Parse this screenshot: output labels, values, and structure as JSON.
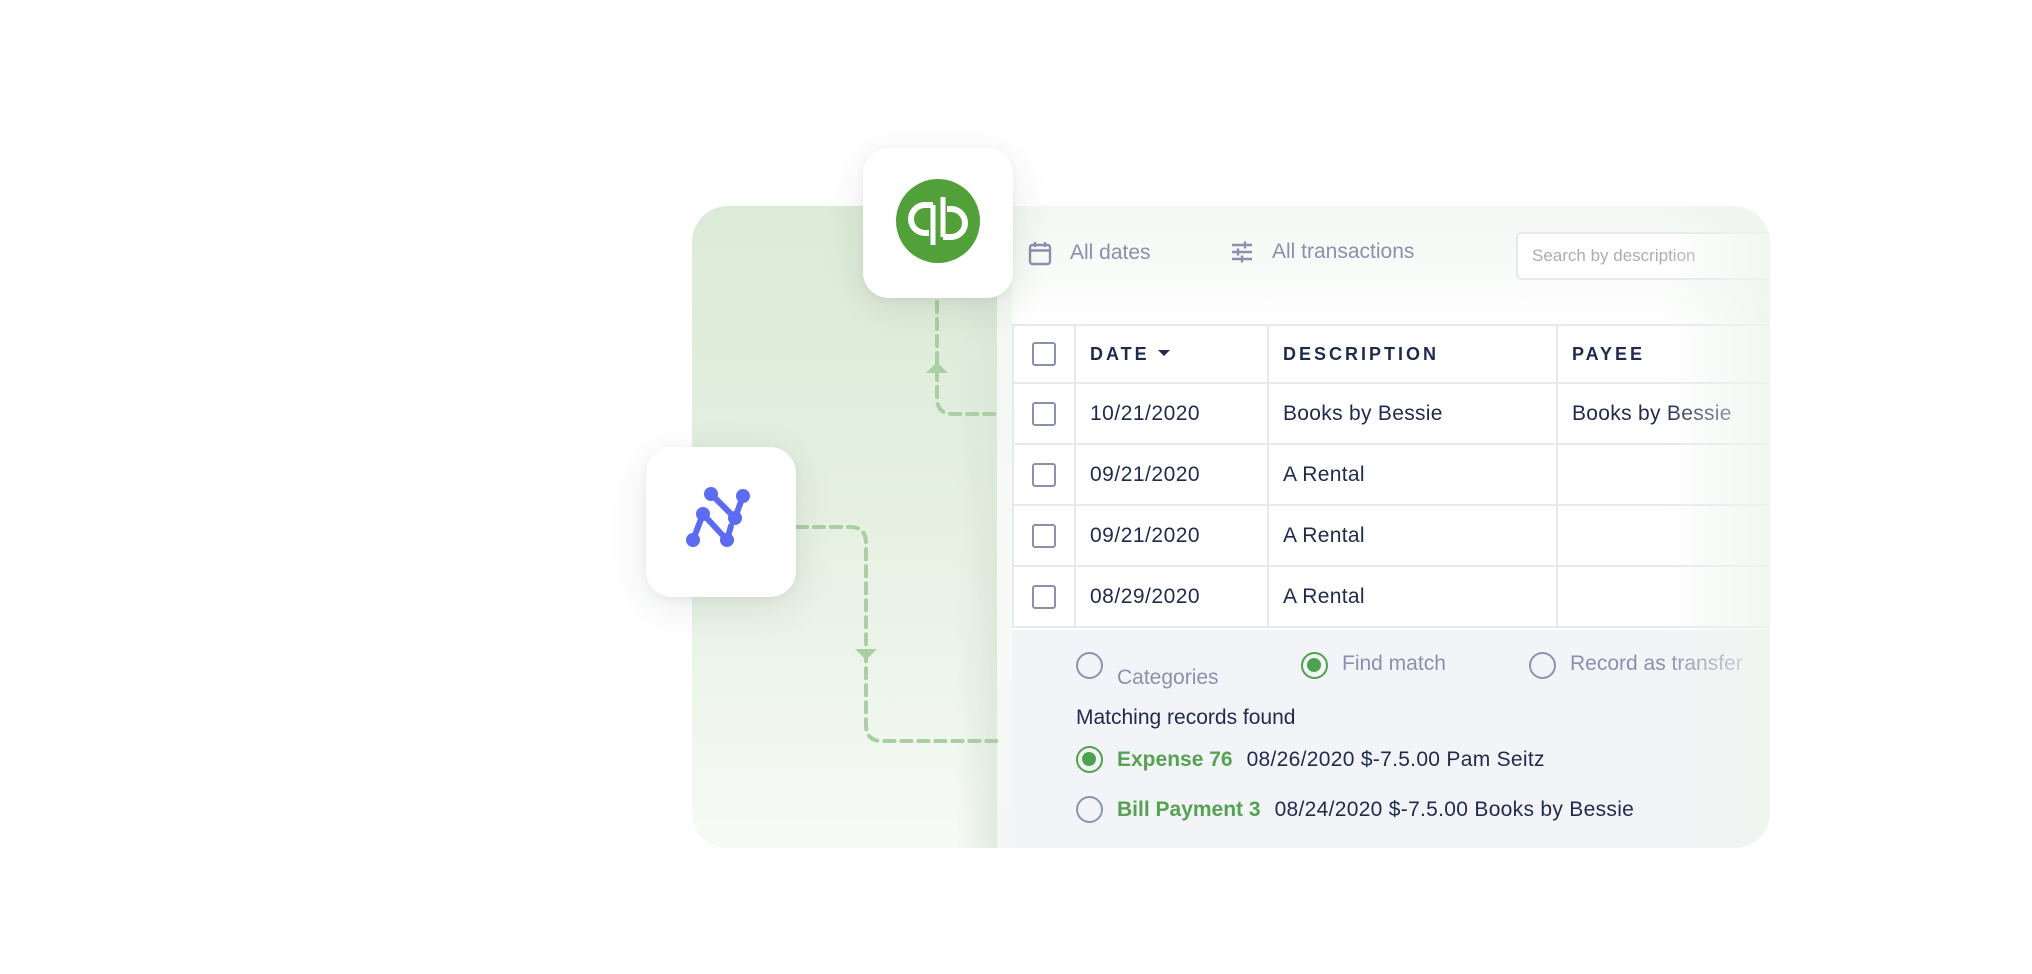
{
  "apps": {
    "source": {
      "name": "QuickBooks",
      "icon": "quickbooks-logo-icon",
      "color": "#52a03a"
    },
    "target": {
      "name": "integration-node-logo",
      "icon": "node-graph-logo-icon",
      "color": "#5b6cf2"
    }
  },
  "toolbar": {
    "date_filter": {
      "icon": "calendar-icon",
      "label": "All dates"
    },
    "type_filter": {
      "icon": "sliders-icon",
      "label": "All transactions"
    },
    "search": {
      "placeholder": "Search by description",
      "value": ""
    }
  },
  "table": {
    "columns": [
      {
        "key": "select",
        "label": ""
      },
      {
        "key": "date",
        "label": "DATE",
        "sorted": "desc"
      },
      {
        "key": "description",
        "label": "DESCRIPTION"
      },
      {
        "key": "payee",
        "label": "PAYEE"
      }
    ],
    "rows": [
      {
        "checked": false,
        "date": "10/21/2020",
        "description": "Books by Bessie",
        "payee": "Books by Bessie"
      },
      {
        "checked": false,
        "date": "09/21/2020",
        "description": "A Rental",
        "payee": ""
      },
      {
        "checked": false,
        "date": "09/21/2020",
        "description": "A Rental",
        "payee": ""
      },
      {
        "checked": false,
        "date": "08/29/2020",
        "description": "A Rental",
        "payee": ""
      }
    ]
  },
  "match_panel": {
    "options": [
      {
        "label": "Categories",
        "selected": false
      },
      {
        "label": "Find match",
        "selected": true
      },
      {
        "label": "Record as transfer",
        "selected": false
      }
    ],
    "heading": "Matching records found",
    "records": [
      {
        "name": "Expense 76",
        "detail": "08/26/2020 $-7.5.00 Pam Seitz",
        "selected": true
      },
      {
        "name": "Bill Payment 3",
        "detail": "08/24/2020 $-7.5.00 Books by Bessie",
        "selected": false
      }
    ]
  },
  "colors": {
    "accent_green": "#4fa24d",
    "text_dark": "#1f2a4d",
    "text_muted": "#8a90ad",
    "connector": "#a9cfa3",
    "node_blue": "#5b6cf2"
  }
}
